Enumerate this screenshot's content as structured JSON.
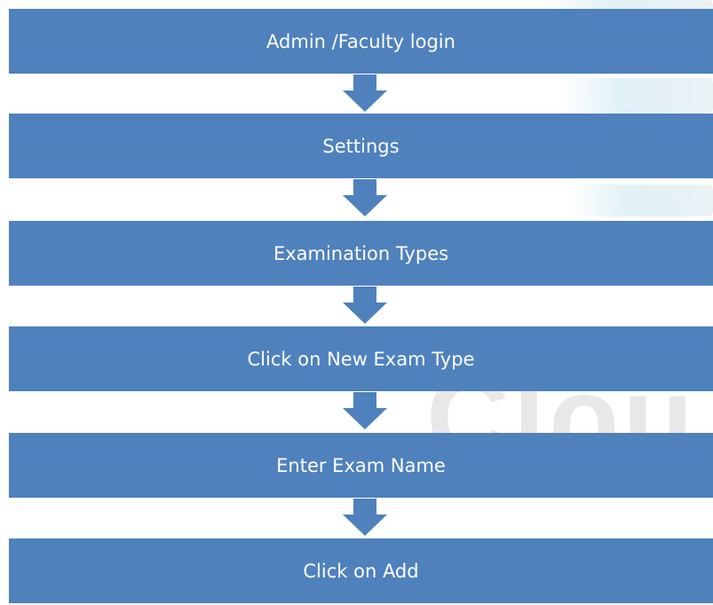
{
  "flowchart": {
    "steps": [
      "Admin /Faculty login",
      "Settings",
      "Examination Types",
      "Click on New Exam Type",
      "Enter Exam Name",
      "Click on Add"
    ]
  },
  "colors": {
    "box_fill": "#4f81bd",
    "box_text": "#ffffff",
    "arrow_fill": "#4f81bd",
    "background": "#ffffff"
  }
}
